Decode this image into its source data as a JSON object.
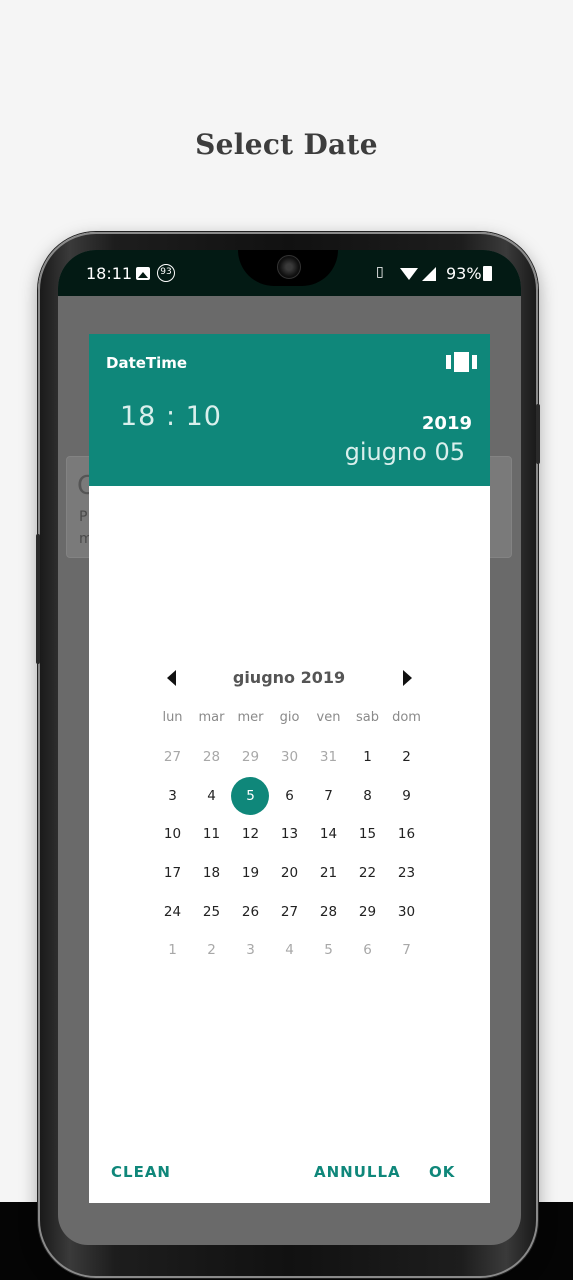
{
  "page": {
    "title": "Select Date"
  },
  "status_bar": {
    "time": "18:11",
    "badge": "93",
    "battery": "93%",
    "icons": [
      "image-icon",
      "notification-badge-icon",
      "vibrate-icon",
      "wifi-icon",
      "signal-icon",
      "battery-icon"
    ]
  },
  "background_card": {
    "initial": "C",
    "line1": "P",
    "line2": "m"
  },
  "dialog": {
    "title": "DateTime",
    "time": "18 : 10",
    "year": "2019",
    "date": "giugno 05",
    "month_label": "giugno 2019",
    "weekdays": [
      "lun",
      "mar",
      "mer",
      "gio",
      "ven",
      "sab",
      "dom"
    ],
    "weeks": [
      [
        {
          "d": "27",
          "m": true
        },
        {
          "d": "28",
          "m": true
        },
        {
          "d": "29",
          "m": true
        },
        {
          "d": "30",
          "m": true
        },
        {
          "d": "31",
          "m": true
        },
        {
          "d": "1"
        },
        {
          "d": "2"
        }
      ],
      [
        {
          "d": "3"
        },
        {
          "d": "4"
        },
        {
          "d": "5",
          "s": true
        },
        {
          "d": "6"
        },
        {
          "d": "7"
        },
        {
          "d": "8"
        },
        {
          "d": "9"
        }
      ],
      [
        {
          "d": "10"
        },
        {
          "d": "11"
        },
        {
          "d": "12"
        },
        {
          "d": "13"
        },
        {
          "d": "14"
        },
        {
          "d": "15"
        },
        {
          "d": "16"
        }
      ],
      [
        {
          "d": "17"
        },
        {
          "d": "18"
        },
        {
          "d": "19"
        },
        {
          "d": "20"
        },
        {
          "d": "21"
        },
        {
          "d": "22"
        },
        {
          "d": "23"
        }
      ],
      [
        {
          "d": "24"
        },
        {
          "d": "25"
        },
        {
          "d": "26"
        },
        {
          "d": "27"
        },
        {
          "d": "28"
        },
        {
          "d": "29"
        },
        {
          "d": "30"
        }
      ],
      [
        {
          "d": "1",
          "m": true
        },
        {
          "d": "2",
          "m": true
        },
        {
          "d": "3",
          "m": true
        },
        {
          "d": "4",
          "m": true
        },
        {
          "d": "5",
          "m": true
        },
        {
          "d": "6",
          "m": true
        },
        {
          "d": "7",
          "m": true
        }
      ]
    ],
    "buttons": {
      "clean": "CLEAN",
      "cancel": "ANNULLA",
      "ok": "OK"
    }
  },
  "colors": {
    "accent": "#0f877a",
    "status_bar": "#031a14"
  }
}
